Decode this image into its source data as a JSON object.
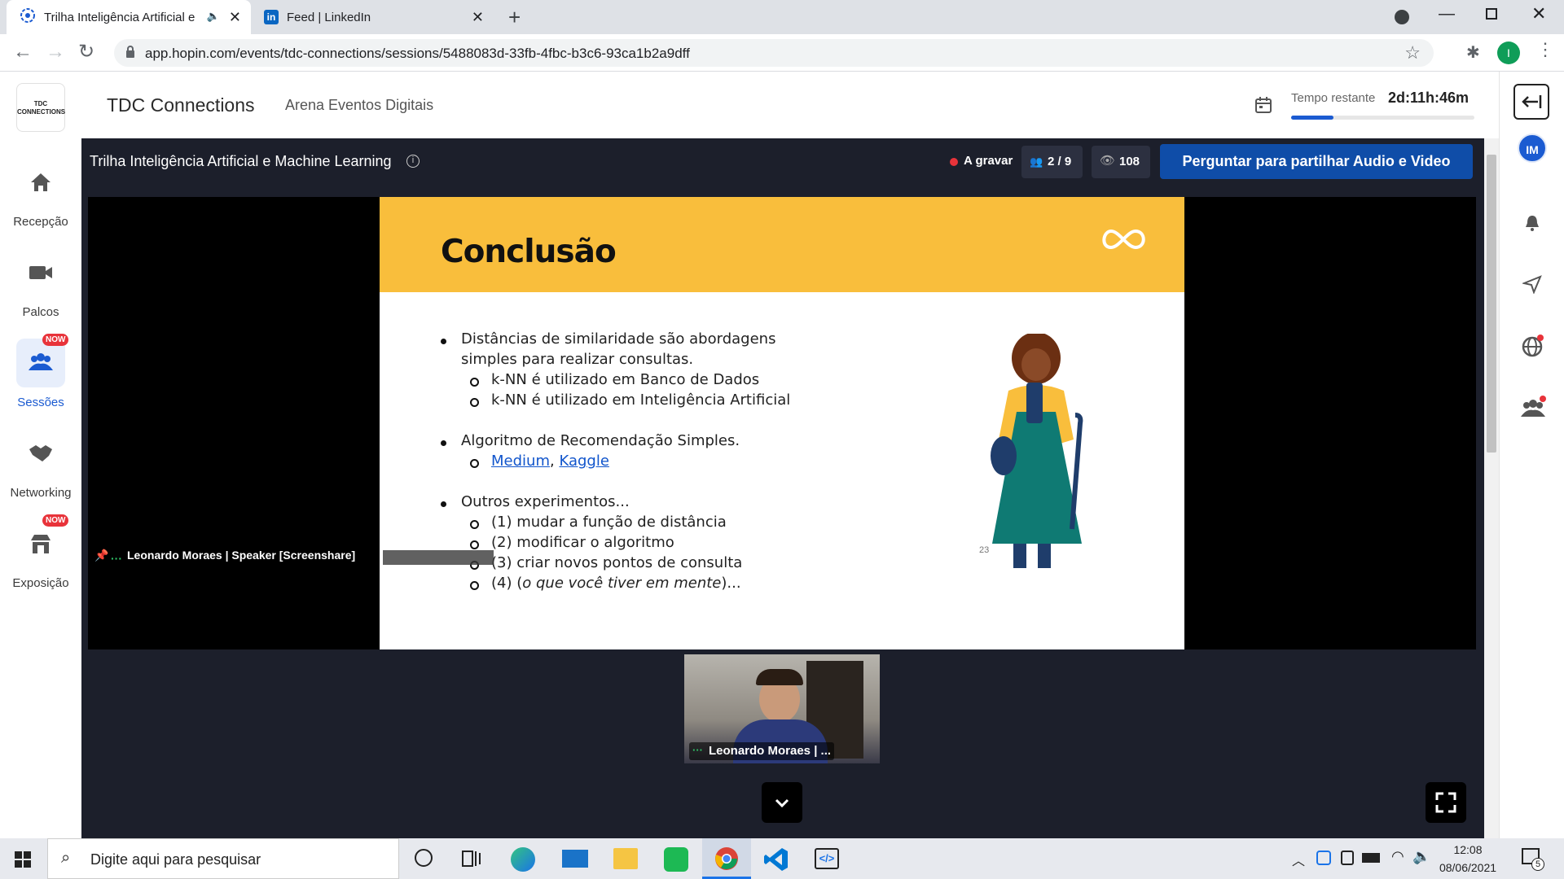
{
  "browser": {
    "tabs": [
      {
        "title": "Trilha Inteligência Artificial e",
        "active": true
      },
      {
        "title": "Feed | LinkedIn",
        "active": false
      }
    ],
    "url": "app.hopin.com/events/tdc-connections/sessions/5488083d-33fb-4fbc-b3c6-93ca1b2a9dff",
    "profile_initial": "I"
  },
  "event": {
    "logo_text": "TDC CONNECTIONS",
    "name": "TDC Connections",
    "organizer": "Arena Eventos Digitais",
    "time_left_label": "Tempo restante",
    "time_left_value": "2d:11h:46m",
    "time_progress": 0.23
  },
  "nav": {
    "items": [
      {
        "label": "Recepção",
        "icon": "home-icon"
      },
      {
        "label": "Palcos",
        "icon": "video-camera-icon"
      },
      {
        "label": "Sessões",
        "icon": "people-icon",
        "badge": "NOW",
        "active": true
      },
      {
        "label": "Networking",
        "icon": "handshake-icon"
      },
      {
        "label": "Exposição",
        "icon": "booth-icon",
        "badge": "NOW"
      }
    ]
  },
  "session": {
    "title": "Trilha Inteligência Artificial e Machine Learning",
    "recording_label": "A gravar",
    "participants": "2 / 9",
    "viewers": "108",
    "ask_button": "Perguntar para partilhar Audio e Video",
    "screenshare_label": "Leonardo Moraes | Speaker [Screenshare]",
    "camera_label": "Leonardo Moraes | ...",
    "user_initials": "IM"
  },
  "slide": {
    "title": "Conclusão",
    "page": "23",
    "b1_line1": "Distâncias de similaridade são abordagens",
    "b1_line2": "simples para realizar consultas.",
    "b1_sub1": "k-NN é utilizado em Banco de Dados",
    "b1_sub2": "k-NN é utilizado em Inteligência Artificial",
    "b2_line1": "Algoritmo de Recomendação Simples.",
    "b2_link1": "Medium",
    "b2_sep": ",",
    "b2_link2": "Kaggle",
    "b3_line1": "Outros experimentos...",
    "b3_sub1": "(1) mudar a função de distância",
    "b3_sub2": "(2) modificar o algoritmo",
    "b3_sub3": "(3) criar novos pontos de consulta",
    "b3_sub4_a": "(4) (",
    "b3_sub4_b": "o que você tiver em mente",
    "b3_sub4_c": ")..."
  },
  "taskbar": {
    "search_placeholder": "Digite aqui para pesquisar",
    "time": "12:08",
    "date": "08/06/2021",
    "notifications": "5"
  },
  "colors": {
    "stage_bg": "#1c1f2b",
    "accent_blue": "#0f4da8",
    "slide_yellow": "#f9be3c",
    "active_nav": "#1b5bd1"
  }
}
